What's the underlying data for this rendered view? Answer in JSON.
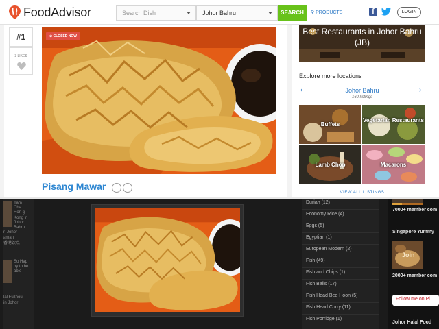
{
  "header": {
    "logo": "FoodAdvisor",
    "search_placeholder": "Search Dish",
    "location": "Johor Bahru",
    "search_button": "SEARCH",
    "products_link": "PRODUCTS",
    "login_button": "LOGIN"
  },
  "dish": {
    "rank": "#1",
    "likes": "3 LIKES",
    "status": "⊘ CLOSED NOW",
    "name": "Pisang Mawar"
  },
  "sidebar": {
    "banner": "Best Restaurants in Johor Bahru (JB)",
    "explore_heading": "Explore more locations",
    "location_name": "Johor Bahru",
    "location_listings": "160 listings",
    "tiles": [
      {
        "label": "Buffets"
      },
      {
        "label": "Vegetarian Restaurants"
      },
      {
        "label": "Lamb Chop"
      },
      {
        "label": "Macarons"
      }
    ],
    "view_all": "VIEW ALL LISTINGS"
  },
  "bottom": {
    "left_items": [
      {
        "text": "Yam Cha Hon g Kong in Johor Bahru"
      },
      {
        "text": "So Hap py to be able"
      }
    ],
    "left_captions": [
      "n Johor",
      "aman",
      "香港饮点",
      "lal Fuzhou",
      "in Johor"
    ],
    "categories": [
      "Durian (12)",
      "Economy Rice (4)",
      "Eggs (5)",
      "Egyptian (1)",
      "European Modern (2)",
      "Fish (49)",
      "Fish and Chips (1)",
      "Fish Balls (17)",
      "Fish Head Bee Hoon (5)",
      "Fish Head Curry (11)",
      "Fish Porridge (1)"
    ],
    "right": {
      "members_top": "7000+ member com",
      "group_name": "Singapore Yummy",
      "thumb_label": "Join",
      "members_bottom": "2000+ member com",
      "follow": "Follow me on Pi",
      "footer": "Johor Halal Food"
    }
  }
}
